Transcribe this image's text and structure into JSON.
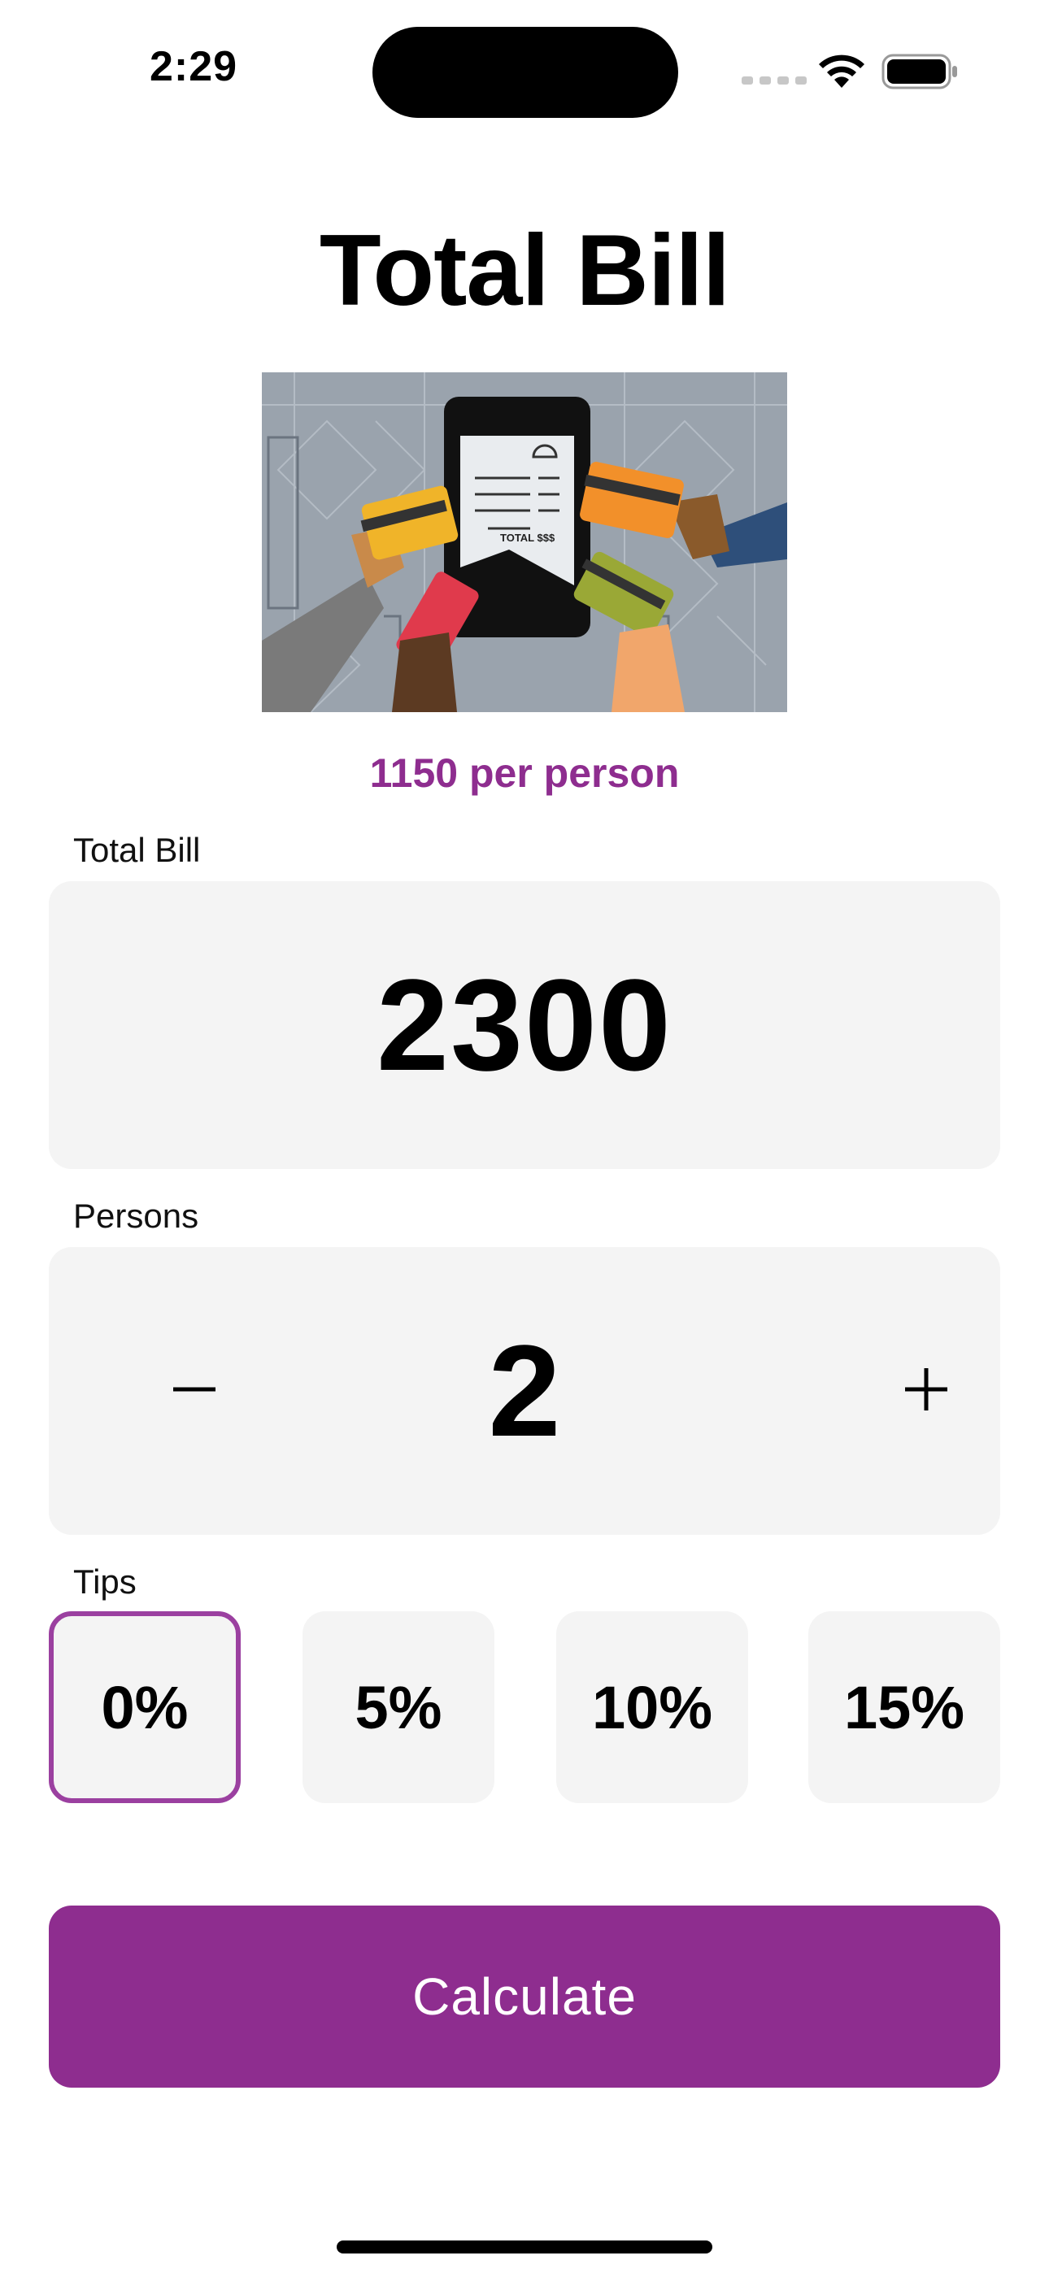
{
  "status_bar": {
    "time": "2:29",
    "icons": [
      "cellular-signal-icon",
      "wifi-icon",
      "battery-icon"
    ]
  },
  "header": {
    "title": "Total Bill"
  },
  "illustration": {
    "name": "bill-split-illustration",
    "receipt_label": "TOTAL $$$"
  },
  "summary": {
    "per_person": "1150 per person"
  },
  "bill": {
    "label": "Total Bill",
    "value": "2300"
  },
  "persons": {
    "label": "Persons",
    "value": "2",
    "decrement_icon": "minus-icon",
    "increment_icon": "plus-icon"
  },
  "tips": {
    "label": "Tips",
    "options": [
      "0%",
      "5%",
      "10%",
      "15%"
    ],
    "selected": "0%"
  },
  "actions": {
    "calculate_label": "Calculate"
  },
  "colors": {
    "accent": "#8e2d8f",
    "selected_border": "#9b40a0",
    "card_background": "#f4f4f4",
    "text": "#000000"
  }
}
